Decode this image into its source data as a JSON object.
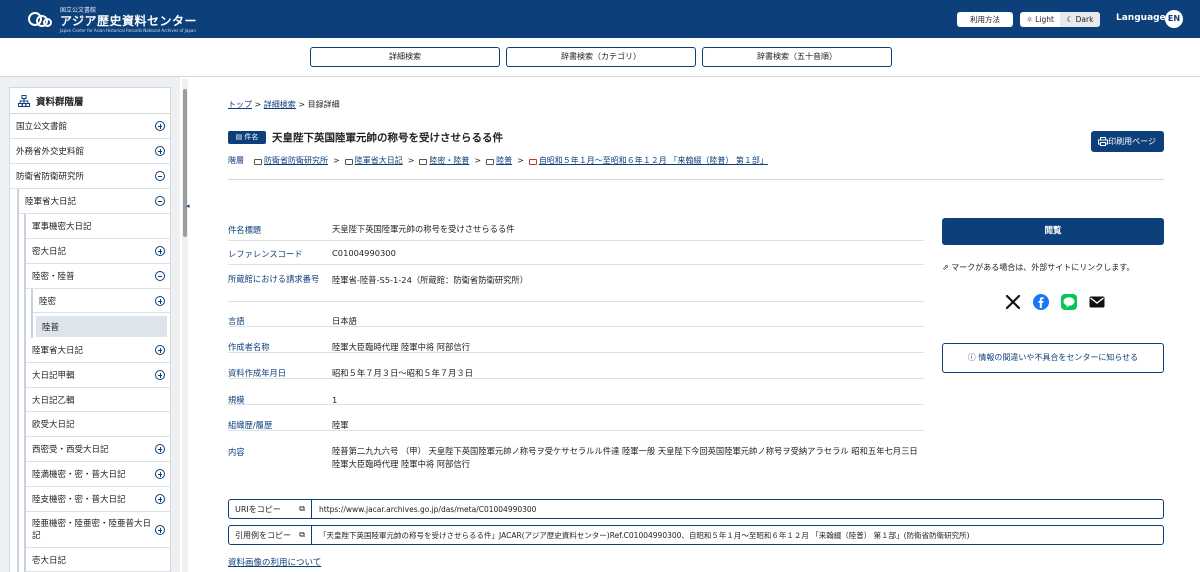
{
  "header": {
    "logo": {
      "sub": "国立公文書館",
      "main": "アジア歴史資料センター",
      "en": "Japan Center for Asian Historical Records  National Archives of Japan"
    },
    "help_label": "利用方法",
    "theme": {
      "light": "☼ Light",
      "dark": "☾ Dark"
    },
    "language_label": "Language",
    "lang_code": "EN"
  },
  "search_bar": {
    "buttons": [
      "詳細検索",
      "辞書検索（カテゴリ）",
      "辞書検索（五十音順）"
    ]
  },
  "sidebar": {
    "title": "資料群階層",
    "items": [
      {
        "label": "国立公文書館",
        "toggle": "plus"
      },
      {
        "label": "外務省外交史料館",
        "toggle": "plus"
      },
      {
        "label": "防衛省防衛研究所",
        "toggle": "minus"
      },
      {
        "label": "陸軍省大日記",
        "toggle": "minus"
      },
      {
        "label": "軍事機密大日記",
        "toggle": ""
      },
      {
        "label": "密大日記",
        "toggle": "plus"
      },
      {
        "label": "陸密・陸普",
        "toggle": "minus"
      },
      {
        "label": "陸密",
        "toggle": "plus"
      },
      {
        "label": "陸普",
        "toggle": ""
      },
      {
        "label": "陸軍省大日記",
        "toggle": "plus"
      },
      {
        "label": "大日記甲輯",
        "toggle": "plus"
      },
      {
        "label": "大日記乙輯",
        "toggle": ""
      },
      {
        "label": "欧受大日記",
        "toggle": ""
      },
      {
        "label": "西密受・西受大日記",
        "toggle": "plus"
      },
      {
        "label": "陸満機密・密・普大日記",
        "toggle": "plus"
      },
      {
        "label": "陸支機密・密・普大日記",
        "toggle": "plus"
      },
      {
        "label": "陸亜機密・陸亜密・陸亜普大日記",
        "toggle": "plus"
      },
      {
        "label": "壱大日記",
        "toggle": ""
      }
    ]
  },
  "breadcrumb": {
    "top": "トップ",
    "search": "詳細検索",
    "current": "目録詳細",
    "sep": ">"
  },
  "record": {
    "badge": "件名",
    "title": "天皇陛下英国陸軍元帥の称号を受けさせらるる件",
    "print_label": "印刷用ページ",
    "hierarchy_label": "階層",
    "hierarchy": [
      "防衛省防衛研究所",
      "陸軍省大日記",
      "陸密・陸普",
      "陸普",
      "自昭和５年１月～至昭和６年１２月 「来翰綴（陸普） 第１部」"
    ],
    "fields": [
      {
        "key": "件名標題",
        "value": "天皇陛下英国陸軍元帥の称号を受けさせらるる件"
      },
      {
        "key": "レファレンスコード",
        "value": "C01004990300"
      },
      {
        "key": "所蔵館における請求番号",
        "value": "陸軍省-陸普-S5-1-24（所蔵館：防衛省防衛研究所）"
      },
      {
        "key": "言語",
        "value": "日本語"
      },
      {
        "key": "作成者名称",
        "value": "陸軍大臣臨時代理 陸軍中将 阿部信行"
      },
      {
        "key": "資料作成年月日",
        "value": "昭和５年７月３日～昭和５年７月３日"
      },
      {
        "key": "規模",
        "value": "1"
      },
      {
        "key": "組織歴/履歴",
        "value": "陸軍"
      },
      {
        "key": "内容",
        "value": "陸普第二九九六号 （甲） 天皇陛下英国陸軍元帥ノ称号ヲ受ケサセラルル件達 陸軍一般 天皇陛下今回英国陸軍元帥ノ称号ヲ受納アラセラル 昭和五年七月三日 陸軍大臣臨時代理 陸軍中将 阿部信行"
      }
    ]
  },
  "side_panel": {
    "view_label": "閲覧",
    "external_note": "マークがある場合は、外部サイトにリンクします。",
    "social_icons": [
      "x-icon",
      "facebook-icon",
      "line-icon",
      "mail-icon"
    ],
    "report_label": "情報の間違いや不具合をセンターに知らせる"
  },
  "copy": {
    "uri_label": "URIをコピー",
    "uri_value": "https://www.jacar.archives.go.jp/das/meta/C01004990300",
    "cite_label": "引用例をコピー",
    "cite_value": "「天皇陛下英国陸軍元帥の称号を受けさせらるる件」JACAR(アジア歴史資料センター)Ref.C01004990300、自昭和５年１月～至昭和６年１２月 「来翰綴（陸普） 第１部」(防衛省防衛研究所)"
  },
  "image_usage_link": "資料画像の利用について",
  "colors": {
    "brand": "#0d3f7a",
    "sidebar_bg": "#eef1f4",
    "selected": "#dde4ec"
  }
}
